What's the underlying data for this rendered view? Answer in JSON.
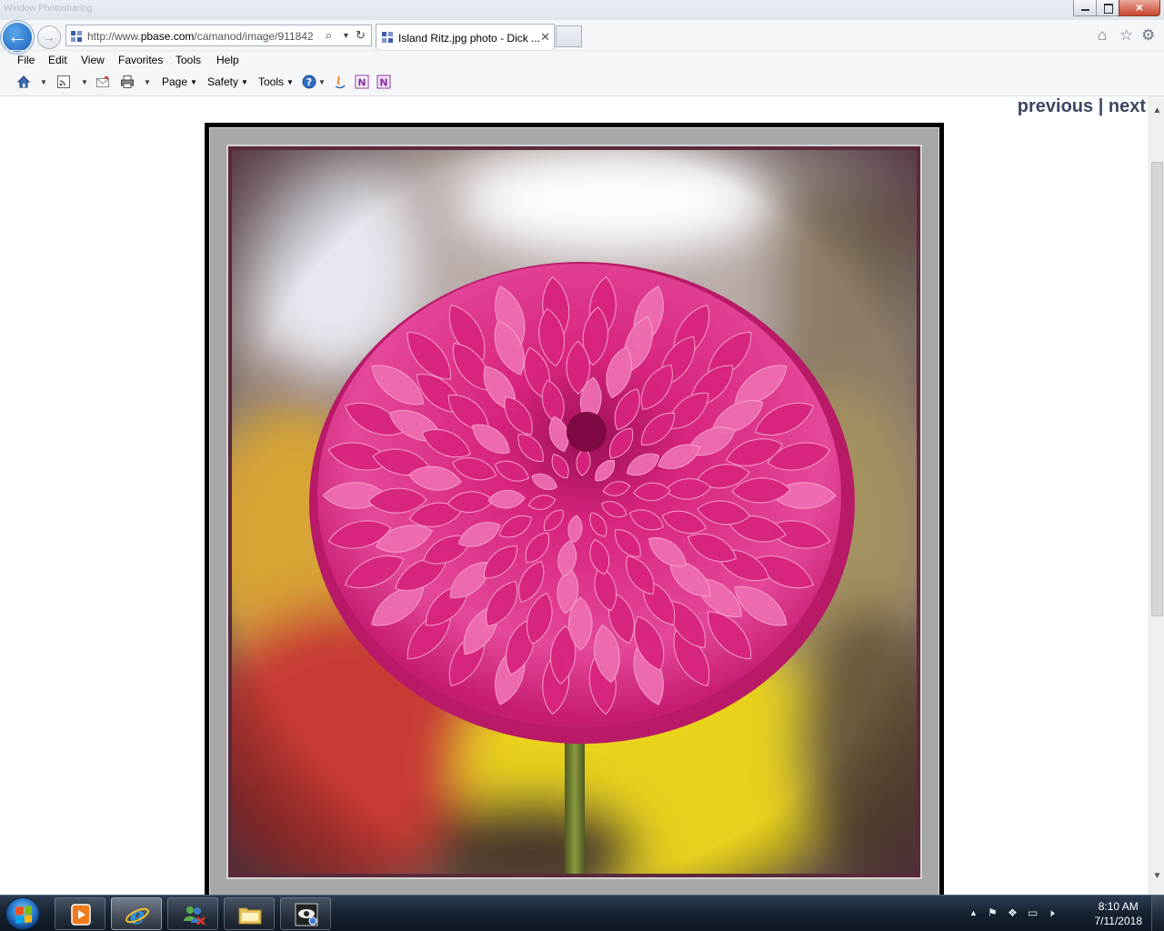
{
  "window": {
    "title_ghost": "Window Photosharing"
  },
  "navigation": {
    "back_label": "Back",
    "forward_label": "Forward",
    "address": {
      "prefix": "http://www.",
      "domain": "pbase.com",
      "suffix": "/camanod/image/911842"
    },
    "tab": {
      "title": "Island Ritz.jpg photo - Dick ..."
    }
  },
  "menu": {
    "items": [
      "File",
      "Edit",
      "View",
      "Favorites",
      "Tools",
      "Help"
    ]
  },
  "command_bar": {
    "page_label": "Page",
    "safety_label": "Safety",
    "tools_label": "Tools"
  },
  "page": {
    "previous_label": "previous",
    "separator": "|",
    "next_label": "next",
    "photo_subject": "pink dahlia"
  },
  "taskbar": {
    "clock_time": "8:10 AM",
    "clock_date": "7/11/2018"
  },
  "colors": {
    "link_color": "#3b4763",
    "petal_main": "#d8247f",
    "petal_light": "#ee6db0",
    "frame_gray": "#a7a7a7"
  },
  "icons": {
    "back": "back-arrow-icon",
    "forward": "forward-arrow-icon",
    "search": "search-icon",
    "refresh": "refresh-icon",
    "home": "home-icon",
    "favorites": "star-icon",
    "settings": "gear-icon"
  }
}
